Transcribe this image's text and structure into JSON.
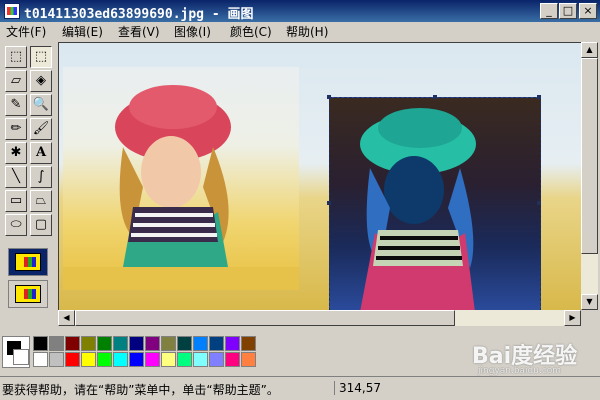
{
  "window": {
    "title": "t01411303ed63899690.jpg - 画图",
    "controls": {
      "minimize": "_",
      "maximize": "□",
      "close": "×"
    }
  },
  "menu": [
    {
      "label": "文件(F)"
    },
    {
      "label": "编辑(E)"
    },
    {
      "label": "查看(V)"
    },
    {
      "label": "图像(I)"
    },
    {
      "label": "颜色(C)"
    },
    {
      "label": "帮助(H)"
    }
  ],
  "tools": [
    {
      "name": "free-select",
      "glyph": "⬚"
    },
    {
      "name": "rect-select",
      "glyph": "⬚"
    },
    {
      "name": "eraser",
      "glyph": "▱"
    },
    {
      "name": "fill",
      "glyph": "◈"
    },
    {
      "name": "color-picker",
      "glyph": "✎"
    },
    {
      "name": "magnifier",
      "glyph": "🔍"
    },
    {
      "name": "pencil",
      "glyph": "✏"
    },
    {
      "name": "brush",
      "glyph": "🖌"
    },
    {
      "name": "airbrush",
      "glyph": "✱"
    },
    {
      "name": "text",
      "glyph": "A"
    },
    {
      "name": "line",
      "glyph": "╲"
    },
    {
      "name": "curve",
      "glyph": "∫"
    },
    {
      "name": "rectangle",
      "glyph": "▭"
    },
    {
      "name": "polygon",
      "glyph": "⏢"
    },
    {
      "name": "ellipse",
      "glyph": "⬭"
    },
    {
      "name": "rounded-rect",
      "glyph": "▢"
    }
  ],
  "palette": {
    "foreground": "#000000",
    "background": "#ffffff",
    "colors_top": [
      "#000000",
      "#808080",
      "#800000",
      "#808000",
      "#008000",
      "#008080",
      "#000080",
      "#800080",
      "#808040",
      "#004040",
      "#0080ff",
      "#004080",
      "#8000ff",
      "#804000"
    ],
    "colors_bottom": [
      "#ffffff",
      "#c0c0c0",
      "#ff0000",
      "#ffff00",
      "#00ff00",
      "#00ffff",
      "#0000ff",
      "#ff00ff",
      "#ffff80",
      "#00ff80",
      "#80ffff",
      "#8080ff",
      "#ff0080",
      "#ff8040"
    ]
  },
  "status": {
    "help_text": "要获得帮助，请在“帮助”菜单中，单击“帮助主题”。",
    "coords": "314,57"
  },
  "watermark": {
    "text": "Bai度经验",
    "url": "jingyan.baidu.com"
  }
}
